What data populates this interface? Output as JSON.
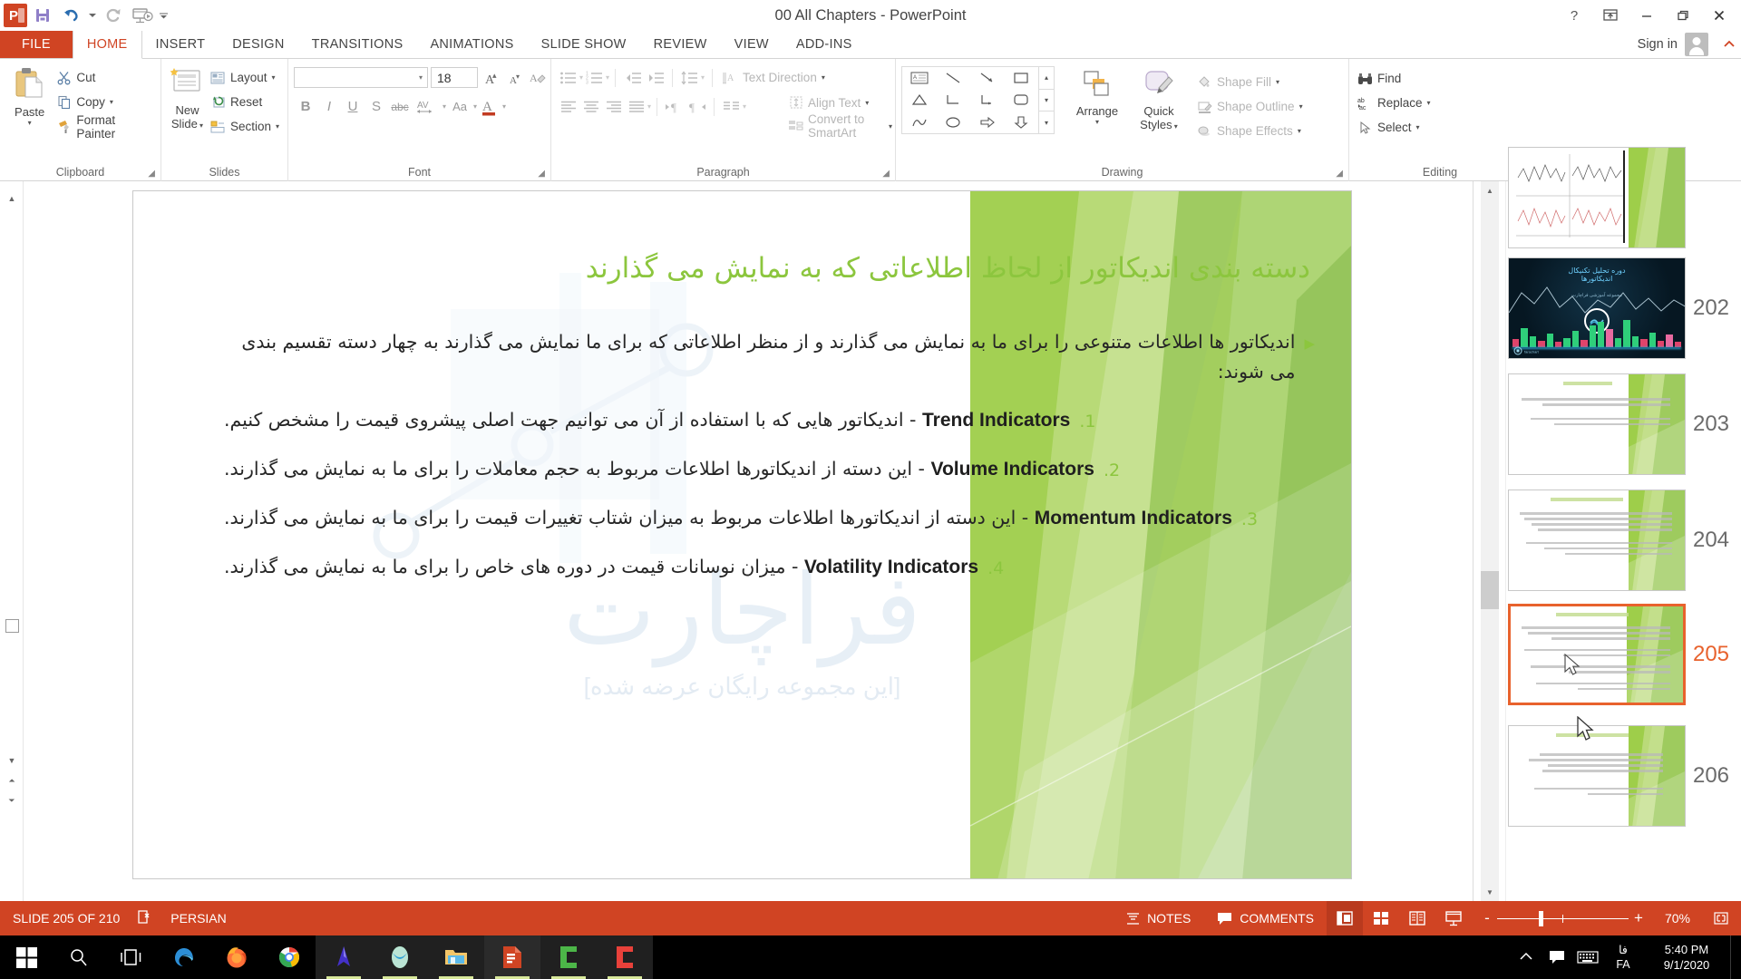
{
  "window": {
    "title": "00 All Chapters - PowerPoint",
    "app_icon": "powerpoint-icon",
    "quick_access": [
      {
        "name": "save-icon",
        "label": "Save"
      },
      {
        "name": "undo-icon",
        "label": "Undo"
      },
      {
        "name": "redo-icon",
        "label": "Redo"
      },
      {
        "name": "start-slideshow-icon",
        "label": "Start From Beginning"
      },
      {
        "name": "customize-qat-icon",
        "label": "Customize Quick Access Toolbar"
      }
    ],
    "controls": {
      "help": "?",
      "ribbon_display": "ribbon-display-options-icon",
      "minimize": "minimize-icon",
      "restore": "restore-icon",
      "close": "close-icon"
    },
    "sign_in": "Sign in"
  },
  "tabs": [
    {
      "label": "FILE",
      "active": false,
      "file": true
    },
    {
      "label": "HOME",
      "active": true,
      "file": false
    },
    {
      "label": "INSERT",
      "active": false,
      "file": false
    },
    {
      "label": "DESIGN",
      "active": false,
      "file": false
    },
    {
      "label": "TRANSITIONS",
      "active": false,
      "file": false
    },
    {
      "label": "ANIMATIONS",
      "active": false,
      "file": false
    },
    {
      "label": "SLIDE SHOW",
      "active": false,
      "file": false
    },
    {
      "label": "REVIEW",
      "active": false,
      "file": false
    },
    {
      "label": "VIEW",
      "active": false,
      "file": false
    },
    {
      "label": "ADD-INS",
      "active": false,
      "file": false
    }
  ],
  "ribbon": {
    "clipboard": {
      "label": "Clipboard",
      "paste": "Paste",
      "cut": "Cut",
      "copy": "Copy",
      "format_painter": "Format Painter"
    },
    "slides": {
      "label": "Slides",
      "new_slide_line1": "New",
      "new_slide_line2": "Slide",
      "layout": "Layout",
      "reset": "Reset",
      "section": "Section"
    },
    "font": {
      "label": "Font",
      "font_name": "",
      "font_name_placeholder": "",
      "font_size": "18",
      "bold": "B",
      "italic": "I",
      "underline": "U",
      "shadow": "S",
      "strikethrough": "abc",
      "char_spacing": "AV",
      "change_case": "Aa",
      "font_color": "A",
      "grow_font": "A",
      "shrink_font": "A",
      "clear_formatting": "clear-formatting-icon"
    },
    "paragraph": {
      "label": "Paragraph",
      "bullets": "bullets-icon",
      "numbering": "numbering-icon",
      "decrease_indent": "decrease-indent-icon",
      "increase_indent": "increase-indent-icon",
      "line_spacing": "line-spacing-icon",
      "align_left": "align-left-icon",
      "align_center": "align-center-icon",
      "align_right": "align-right-icon",
      "justify": "justify-icon",
      "ltr": "left-to-right-icon",
      "rtl": "right-to-left-icon",
      "columns": "columns-icon",
      "text_direction": "Text Direction",
      "align_text": "Align Text",
      "convert_smartart": "Convert to SmartArt"
    },
    "drawing": {
      "label": "Drawing",
      "arrange": "Arrange",
      "quick_styles_line1": "Quick",
      "quick_styles_line2": "Styles",
      "shape_fill": "Shape Fill",
      "shape_outline": "Shape Outline",
      "shape_effects": "Shape Effects"
    },
    "editing": {
      "label": "Editing",
      "find": "Find",
      "replace": "Replace",
      "select": "Select"
    }
  },
  "slide": {
    "title": "دسته بندی اندیکاتور از لحاظ اطلاعاتی که به نمایش می گذارند",
    "watermark": "فراچارت",
    "watermark_sub": "[این مجموعه رایگان عرضه شده]",
    "intro": "اندیکاتور ها اطلاعات متنوعی را برای ما به نمایش می گذارند و از منظر اطلاعاتی که برای ما نمایش می گذارند به چهار دسته تقسیم بندی می شوند:",
    "items": [
      {
        "number": "1.",
        "en": "Trend Indicators",
        "fa_before": "",
        "fa": "- اندیکاتور هایی که با استفاده از آن می توانیم جهت اصلی پیشروی قیمت را مشخص کنیم."
      },
      {
        "number": "2.",
        "en": "Volume Indicators",
        "fa_before": "",
        "fa": "- این دسته از اندیکاتورها اطلاعات مربوط به حجم معاملات را برای ما به نمایش می گذارند."
      },
      {
        "number": "3.",
        "en": "Momentum Indicators",
        "fa_before": "",
        "fa": "- این دسته از اندیکاتورها اطلاعات مربوط به میزان شتاب تغییرات قیمت را برای ما به نمایش می گذارند."
      },
      {
        "number": "4.",
        "en": "Volatility Indicators",
        "fa_before": "",
        "fa": "- میزان نوسانات قیمت در دوره های خاص را برای ما به نمایش می گذارند."
      }
    ]
  },
  "thumbnails": [
    {
      "number": "",
      "selected": false,
      "kind": "linechart"
    },
    {
      "number": "202",
      "selected": false,
      "kind": "dark"
    },
    {
      "number": "203",
      "selected": false,
      "kind": "text"
    },
    {
      "number": "204",
      "selected": false,
      "kind": "text"
    },
    {
      "number": "205",
      "selected": true,
      "kind": "text"
    },
    {
      "number": "206",
      "selected": false,
      "kind": "text"
    }
  ],
  "statusbar": {
    "slide_counter": "SLIDE 205 OF 210",
    "language_icon": "spellcheck-icon",
    "language": "PERSIAN",
    "notes": "NOTES",
    "comments": "COMMENTS",
    "views": [
      {
        "name": "normal-view",
        "active": true
      },
      {
        "name": "slide-sorter-view",
        "active": false
      },
      {
        "name": "reading-view",
        "active": false
      },
      {
        "name": "slideshow-view",
        "active": false
      }
    ],
    "zoom_out": "-",
    "zoom_in": "+",
    "zoom_level": "70%",
    "fit_to_window": "fit-slide-icon"
  },
  "taskbar": {
    "start": "start-icon",
    "search": "search-icon",
    "task_view": "task-view-icon",
    "apps": [
      {
        "name": "edge-icon",
        "active": false
      },
      {
        "name": "firefox-icon",
        "active": false
      },
      {
        "name": "chrome-icon",
        "active": false
      },
      {
        "name": "amibroker-icon",
        "active": false
      },
      {
        "name": "metatrader-icon",
        "active": false
      },
      {
        "name": "file-explorer-icon",
        "active": false
      },
      {
        "name": "powerpoint-icon",
        "active": true
      },
      {
        "name": "camtasia-green-icon",
        "active": false
      },
      {
        "name": "camtasia-red-icon",
        "active": false
      }
    ],
    "tray": {
      "show_hidden": "chevron-up-icon",
      "action_center": "action-center-icon",
      "touch_keyboard": "touch-keyboard-icon",
      "lang_top": "فا",
      "lang_bottom": "FA",
      "time": "5:40 PM",
      "date": "9/1/2020"
    }
  },
  "colors": {
    "accent_red": "#d04423",
    "slide_green": "#8cc63e",
    "selection_orange": "#e8622d"
  }
}
